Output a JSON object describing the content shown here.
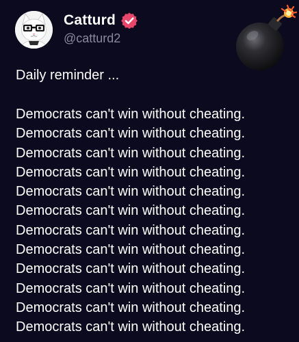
{
  "author": {
    "display_name": "Catturd",
    "handle": "@catturd2",
    "verified": true,
    "avatar_icon": "cat-with-glasses-avatar",
    "verified_icon": "verified-badge-icon",
    "verified_color": "#e8466a"
  },
  "emoji": {
    "icon": "bomb-icon"
  },
  "tweet": {
    "intro": "Daily reminder ...",
    "lines": [
      "Democrats can't win without cheating.",
      "Democrats can't win without cheating.",
      "Democrats can't win without cheating.",
      "Democrats can't win without cheating.",
      "Democrats can't win without cheating.",
      "Democrats can't win without cheating.",
      "Democrats can't win without cheating.",
      "Democrats can't win without cheating.",
      "Democrats can't win without cheating.",
      "Democrats can't win without cheating.",
      "Democrats can't win without cheating.",
      "Democrats can't win without cheating."
    ]
  },
  "colors": {
    "background": "#0c0a1e",
    "text": "#ffffff",
    "muted": "#8b8a9b"
  }
}
